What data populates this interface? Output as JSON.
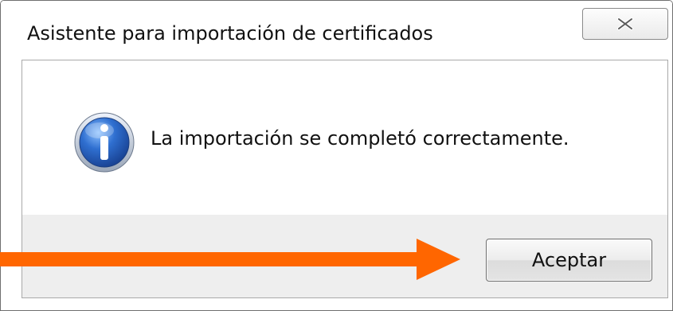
{
  "window": {
    "title": "Asistente para importación de certificados",
    "close_icon": "close-x-icon"
  },
  "dialog": {
    "icon": "information-icon",
    "message": "La importación se completó correctamente."
  },
  "buttons": {
    "accept_label": "Aceptar"
  },
  "annotation": {
    "type": "arrow",
    "points_to": "accept-button",
    "color": "#ff6600"
  },
  "colors": {
    "info_icon_blue": "#2f6fd0",
    "button_bar": "#eeeeee"
  }
}
